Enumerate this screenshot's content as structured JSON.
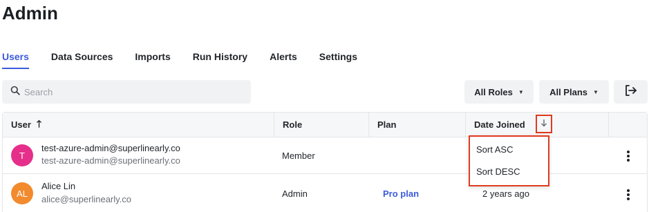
{
  "page": {
    "title": "Admin"
  },
  "tabs": [
    {
      "label": "Users",
      "active": true
    },
    {
      "label": "Data Sources",
      "active": false
    },
    {
      "label": "Imports",
      "active": false
    },
    {
      "label": "Run History",
      "active": false
    },
    {
      "label": "Alerts",
      "active": false
    },
    {
      "label": "Settings",
      "active": false
    }
  ],
  "toolbar": {
    "search_placeholder": "Search",
    "roles_filter": "All Roles",
    "plans_filter": "All Plans",
    "logout_icon": "logout-arrow-icon"
  },
  "table": {
    "columns": {
      "user": "User",
      "role": "Role",
      "plan": "Plan",
      "date_joined": "Date Joined"
    },
    "rows": [
      {
        "initials": "T",
        "name": "test-azure-admin@superlinearly.co",
        "email": "test-azure-admin@superlinearly.co",
        "role": "Member",
        "plan": "",
        "date_joined": ""
      },
      {
        "initials": "AL",
        "name": "Alice Lin",
        "email": "alice@superlinearly.co",
        "role": "Admin",
        "plan": "Pro plan",
        "date_joined": "2 years ago"
      }
    ]
  },
  "sort_menu": {
    "asc": "Sort ASC",
    "desc": "Sort DESC"
  },
  "colors": {
    "accent": "#3b5bdb",
    "highlight": "#e0391f",
    "avatar_t": "#e52f8a",
    "avatar_al": "#f28a2e"
  }
}
